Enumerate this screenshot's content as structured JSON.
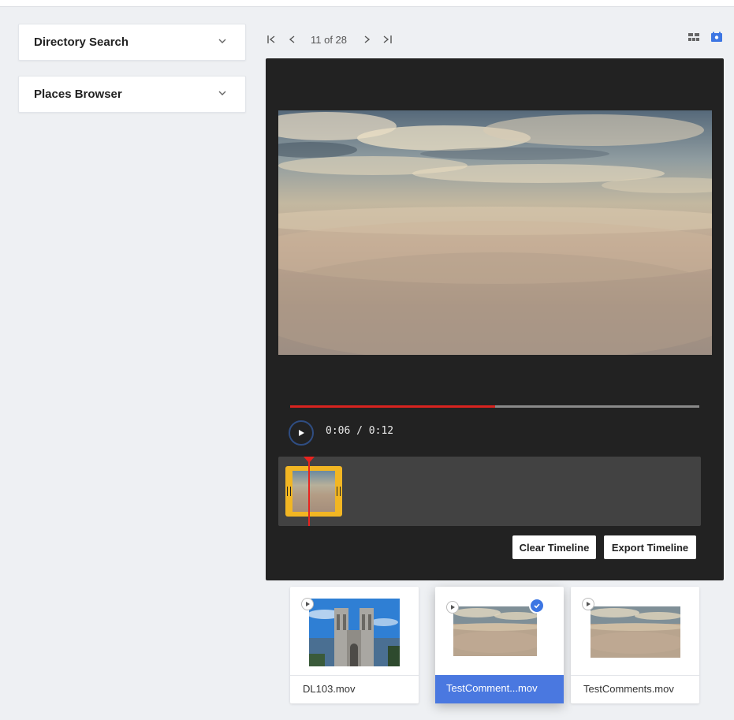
{
  "sidebar": {
    "panels": [
      {
        "title": "Directory Search"
      },
      {
        "title": "Places Browser"
      }
    ]
  },
  "pager": {
    "count_text": "11 of 28"
  },
  "player": {
    "time_text": "0:06 / 0:12",
    "progress": 0.5,
    "clear_timeline_label": "Clear Timeline",
    "export_timeline_label": "Export Timeline"
  },
  "thumbnails": [
    {
      "name": "DL103.mov",
      "selected": false
    },
    {
      "name": "TestComment...mov",
      "selected": true
    },
    {
      "name": "TestComments.mov",
      "selected": false
    }
  ],
  "colors": {
    "accent": "#4a78e0",
    "progress": "#d9231f",
    "timeline_clip": "#f2b623",
    "player_bg": "#222222"
  },
  "icons": {
    "first_page": "first-page-icon",
    "prev_page": "chevron-left-icon",
    "next_page": "chevron-right-icon",
    "last_page": "last-page-icon",
    "list_view": "list-view-icon",
    "gallery_view": "gallery-view-icon",
    "play": "play-icon",
    "check": "check-icon"
  }
}
